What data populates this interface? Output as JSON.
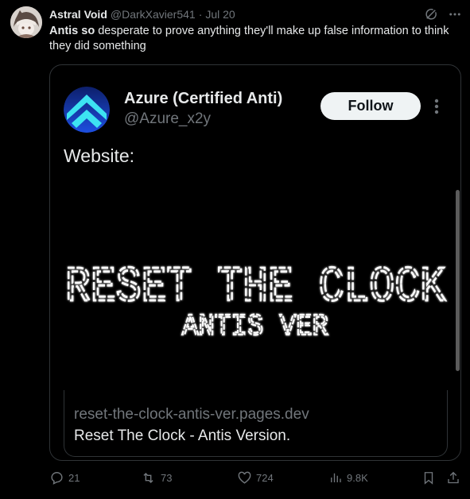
{
  "author": {
    "display_name": "Astral Void",
    "handle": "@DarkXavier541",
    "separator": "·",
    "date": "Jul 20"
  },
  "tweet": {
    "text_bold": "Antis so",
    "text_rest": " desperate to prove anything they'll make up false information to think they did something"
  },
  "quote": {
    "display_name": "Azure (Certified Anti)",
    "handle": "@Azure_x2y",
    "follow_label": "Follow",
    "body": "Website:",
    "media": {
      "line1": "RESET THE CLOCK",
      "line2": "ANTIS VER"
    },
    "link": {
      "domain": "reset-the-clock-antis-ver.pages.dev",
      "title": "Reset The Clock - Antis Version."
    }
  },
  "actions": {
    "replies": "21",
    "reposts": "73",
    "likes": "724",
    "views": "9.8K"
  },
  "colors": {
    "background": "#000000",
    "text": "#e7e9ea",
    "muted": "#71767b",
    "border": "#2f3336",
    "follow_bg": "#eff3f4",
    "logo_cyan": "#3de3f2",
    "logo_blue": "#1d4fe0"
  },
  "icons": [
    "grok-icon",
    "more-icon",
    "reply-icon",
    "repost-icon",
    "like-icon",
    "views-icon",
    "bookmark-icon",
    "share-icon"
  ]
}
